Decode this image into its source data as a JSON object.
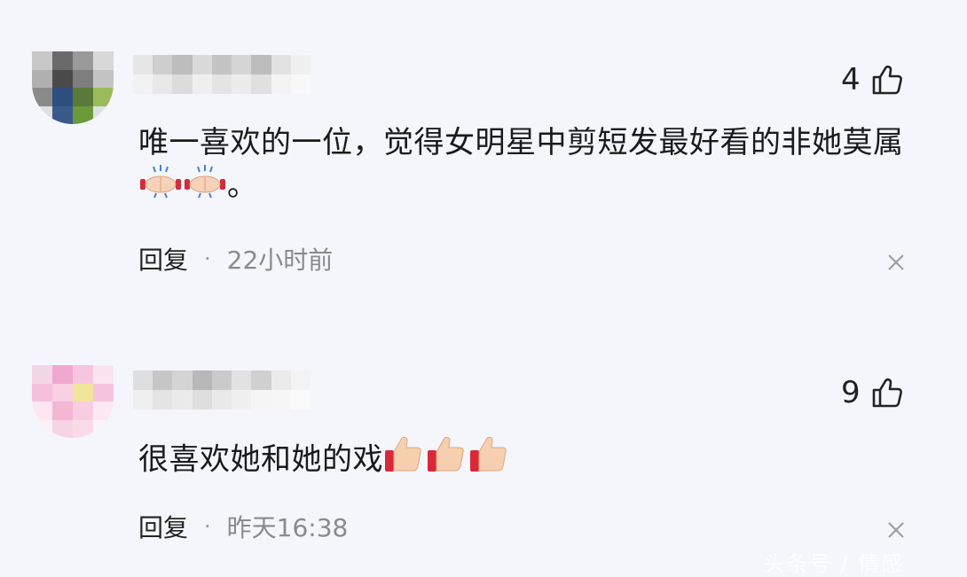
{
  "comments": [
    {
      "like_count": "4",
      "text_line1": "唯一喜欢的一位，觉得女明星中剪短发最好看的非她莫属",
      "text_line2_suffix": "。",
      "reply_label": "回复",
      "separator": "·",
      "time": "22小时前",
      "avatar_colors": [
        "#c8c8c8",
        "#6a6a6a",
        "#9a9a9a",
        "#d8d8d8",
        "#b0b0b0",
        "#4b4b4b",
        "#7e7e7e",
        "#c4c4c4",
        "#8a8a8a",
        "#2f4f7f",
        "#5a7a3a",
        "#9bbb5a",
        "#e0e0e0",
        "#3a5a8a",
        "#6a9a3a",
        "#e0e0e0"
      ],
      "inline_emojis": [
        "applause-emoji",
        "applause-emoji"
      ]
    },
    {
      "like_count": "9",
      "text_line1": "很喜欢她和她的戏",
      "reply_label": "回复",
      "separator": "·",
      "time": "昨天16:38",
      "avatar_colors": [
        "#f3d7e7",
        "#f0a8d0",
        "#f6c6e0",
        "#fbe4f0",
        "#f6c0dc",
        "#f8d0e4",
        "#f2e49a",
        "#f7c4de",
        "#fde6f0",
        "#f3b6d4",
        "#f8cde2",
        "#fbe8f2",
        "#fff0f6",
        "#f6d4e6",
        "#fadbea",
        "#fff3f8"
      ],
      "inline_emojis": [
        "thumbs-up-emoji",
        "thumbs-up-emoji",
        "thumbs-up-emoji"
      ]
    }
  ],
  "watermark": "头条号 / 情感"
}
